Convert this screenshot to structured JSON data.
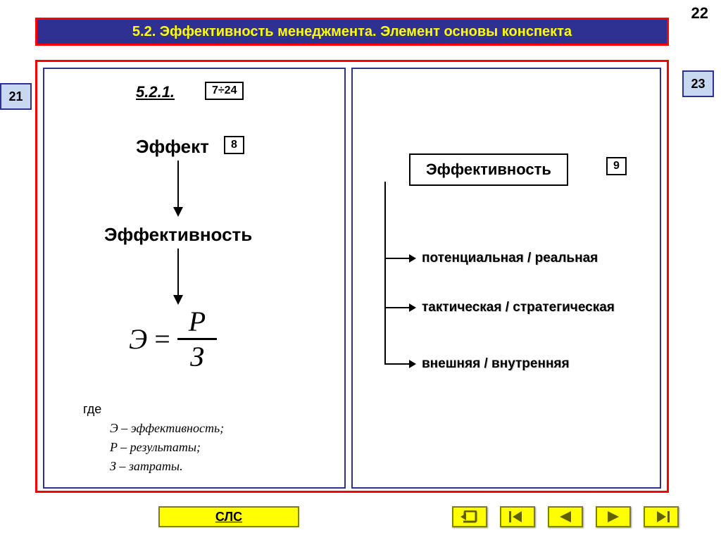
{
  "page": {
    "current": "22",
    "prev": "21",
    "next": "23"
  },
  "title": "5.2. Эффективность менеджмента. Элемент основы конспекта",
  "section": "5.2.1.",
  "refs": {
    "r1": "7÷24",
    "r2": "8",
    "r3": "9"
  },
  "left": {
    "word1": "Эффект",
    "word2": "Эффективность",
    "formula": {
      "lhs": "Э",
      "eq": "=",
      "num": "P",
      "den": "З"
    },
    "legend_label": "где",
    "legend_e": "Э – эффективность;",
    "legend_p": "P – результаты;",
    "legend_z": "З – затраты."
  },
  "right": {
    "head": "Эффективность",
    "b1": "потенциальная / реальная",
    "b2": "тактическая / стратегическая",
    "b3": "внешняя / внутренняя"
  },
  "footer": {
    "sls": "СЛС"
  }
}
